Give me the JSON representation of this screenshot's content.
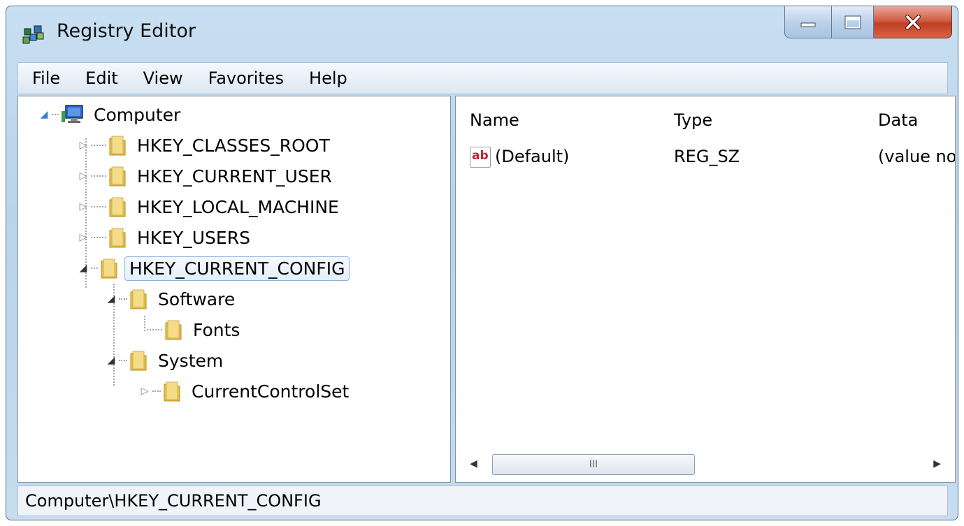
{
  "window": {
    "title": "Registry Editor"
  },
  "menu": [
    "File",
    "Edit",
    "View",
    "Favorites",
    "Help"
  ],
  "tree": {
    "root": "Computer",
    "hives": [
      {
        "label": "HKEY_CLASSES_ROOT",
        "state": "collapsed"
      },
      {
        "label": "HKEY_CURRENT_USER",
        "state": "collapsed"
      },
      {
        "label": "HKEY_LOCAL_MACHINE",
        "state": "collapsed"
      },
      {
        "label": "HKEY_USERS",
        "state": "collapsed"
      },
      {
        "label": "HKEY_CURRENT_CONFIG",
        "state": "expanded",
        "selected": true
      }
    ],
    "config_children": [
      {
        "label": "Software",
        "state": "expanded"
      },
      {
        "label": "Fonts",
        "state": "leaf"
      },
      {
        "label": "System",
        "state": "expanded"
      },
      {
        "label": "CurrentControlSet",
        "state": "collapsed"
      }
    ]
  },
  "list": {
    "columns": [
      "Name",
      "Type",
      "Data"
    ],
    "rows": [
      {
        "icon": "ab",
        "name": "(Default)",
        "type": "REG_SZ",
        "data": "(value no"
      }
    ],
    "scroll_thumb_grip": "III"
  },
  "status": {
    "path": "Computer\\HKEY_CURRENT_CONFIG"
  },
  "colors": {
    "folder": "#e8c44a",
    "selection_border": "#8eb3dc",
    "close_button": "#c13e22"
  }
}
